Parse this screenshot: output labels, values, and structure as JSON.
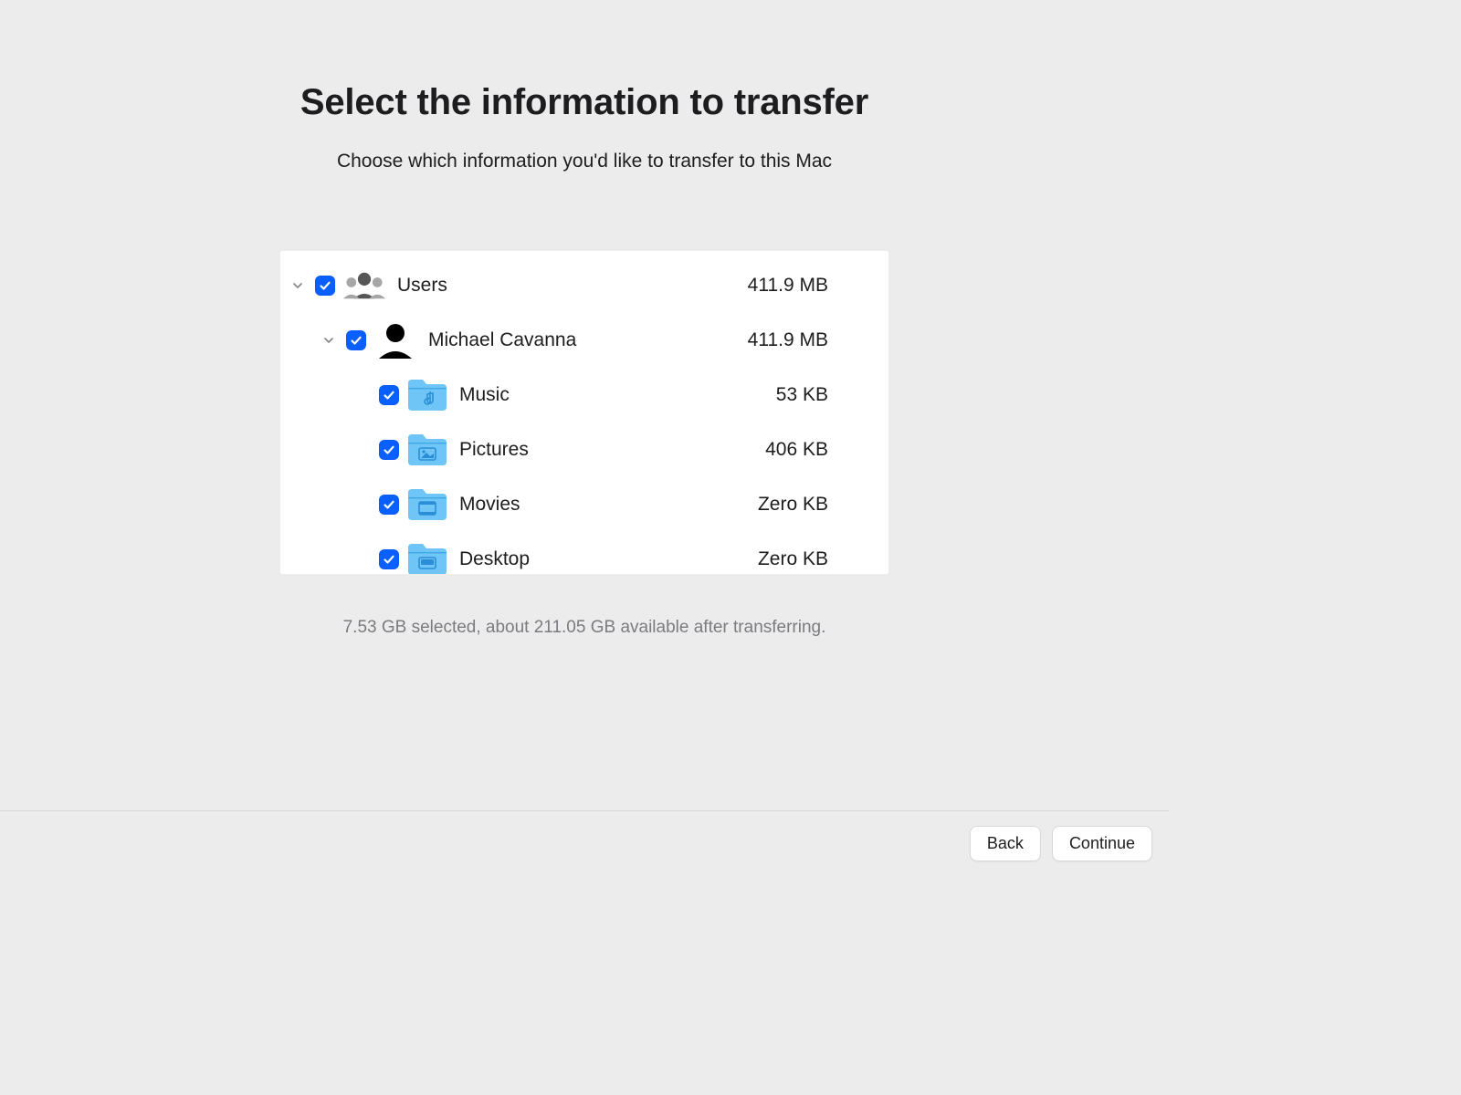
{
  "header": {
    "title": "Select the information to transfer",
    "subtitle": "Choose which information you'd like to transfer to this Mac"
  },
  "tree": {
    "root": {
      "label": "Users",
      "size": "411.9 MB"
    },
    "user": {
      "label": "Michael Cavanna",
      "size": "411.9 MB"
    },
    "items": [
      {
        "label": "Music",
        "size": "53 KB"
      },
      {
        "label": "Pictures",
        "size": "406 KB"
      },
      {
        "label": "Movies",
        "size": "Zero KB"
      },
      {
        "label": "Desktop",
        "size": "Zero KB"
      }
    ]
  },
  "status": "7.53 GB selected, about 211.05 GB available after transferring.",
  "footer": {
    "back_label": "Back",
    "continue_label": "Continue"
  }
}
